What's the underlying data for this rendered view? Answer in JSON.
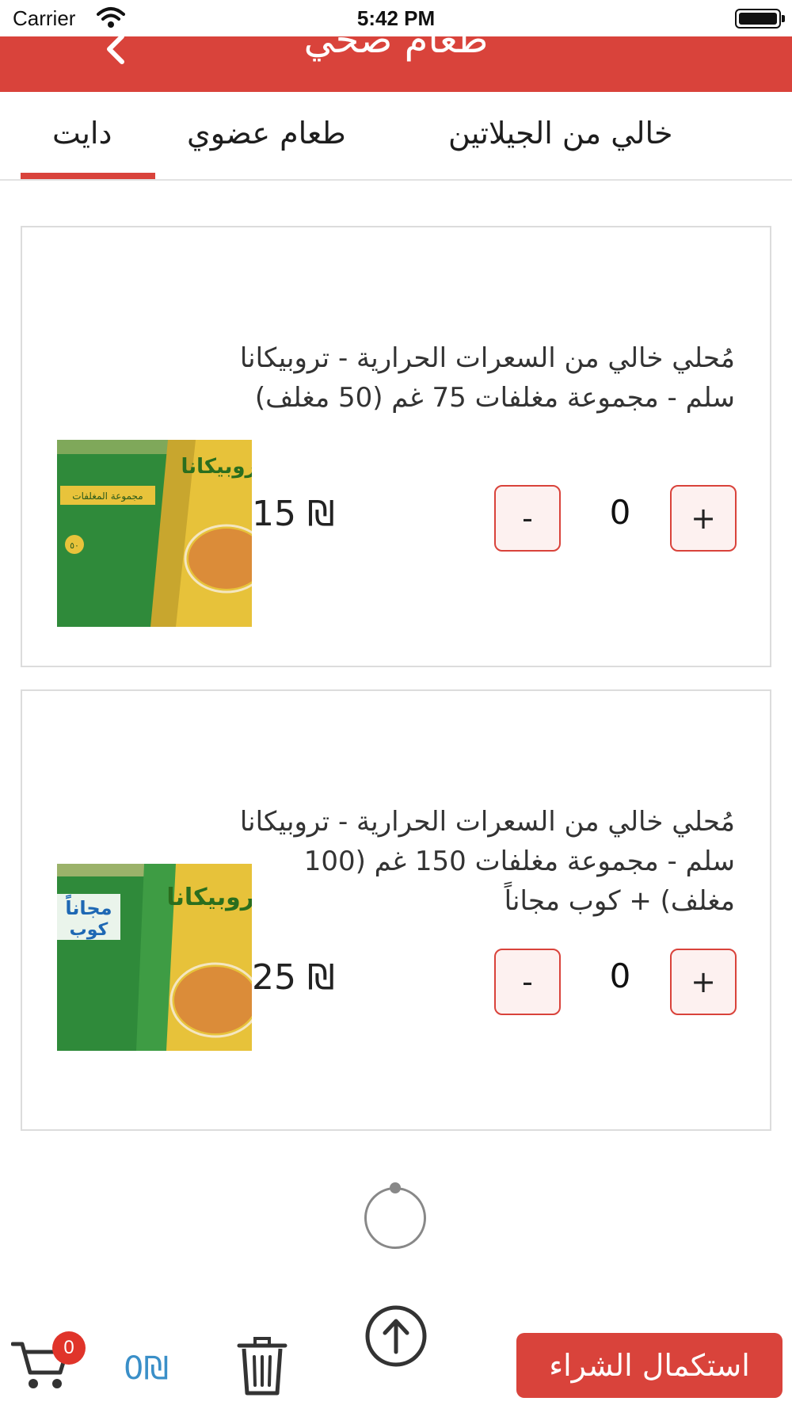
{
  "status_bar": {
    "carrier": "Carrier",
    "time": "5:42 PM"
  },
  "header": {
    "title": "طعام صحي"
  },
  "tabs": [
    {
      "label": "خالي من الجيلاتين"
    },
    {
      "label": "طعام عضوي"
    },
    {
      "label": "دايت",
      "selected": true
    }
  ],
  "products": [
    {
      "description": "مُحلي خالي من السعرات الحرارية - تروبيكانا سلم - مجموعة مغلفات 75 غم (50 مغلف)",
      "quantity": "0",
      "price": "15 ₪",
      "plus_label": "+",
      "minus_label": "-",
      "image": {
        "brand_text": "تروبيكانا",
        "band_text": "مجموعة المغلفات",
        "badge": "٥٠"
      }
    },
    {
      "description": "مُحلي خالي من السعرات الحرارية - تروبيكانا سلم - مجموعة مغلفات 150 غم (100 مغلف) + كوب مجاناً",
      "quantity": "0",
      "price": "25 ₪",
      "plus_label": "+",
      "minus_label": "-",
      "image": {
        "brand_text": "تروبيكانا",
        "promo_top": "مجاناً",
        "promo_bottom": "كوب"
      }
    }
  ],
  "bottom_bar": {
    "cart_count": "0",
    "cart_total": "0₪",
    "checkout_label": "استكمال الشراء"
  },
  "colors": {
    "brand_red": "#d9433b",
    "cart_total_blue": "#3a8fc8",
    "badge_red": "#e0342a"
  },
  "icons": [
    "wifi-icon",
    "battery-icon",
    "back-chevron-icon",
    "scroll-top-icon",
    "cart-icon",
    "trash-icon",
    "loading-spinner"
  ]
}
